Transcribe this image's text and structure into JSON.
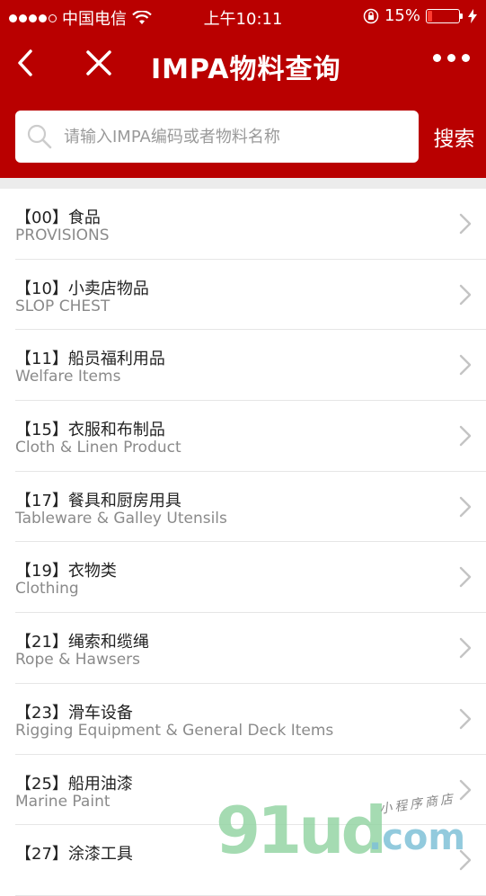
{
  "status_bar": {
    "carrier": "中国电信",
    "time": "上午10:11",
    "battery_percent": "15%",
    "battery_level": 0.15,
    "signal_bars_filled": 4,
    "signal_bars_total": 5
  },
  "nav": {
    "title": "IMPA物料查询",
    "back_icon": "chevron-left-icon",
    "close_icon": "close-icon",
    "more_icon": "more-dots-icon"
  },
  "search": {
    "placeholder": "请输入IMPA编码或者物料名称",
    "value": "",
    "button_label": "搜索"
  },
  "categories": [
    {
      "title": "【00】食品",
      "subtitle": "PROVISIONS"
    },
    {
      "title": "【10】小卖店物品",
      "subtitle": "SLOP CHEST"
    },
    {
      "title": "【11】船员福利用品",
      "subtitle": "Welfare Items"
    },
    {
      "title": "【15】衣服和布制品",
      "subtitle": "Cloth & Linen Product"
    },
    {
      "title": "【17】餐具和厨房用具",
      "subtitle": "Tableware & Galley Utensils"
    },
    {
      "title": "【19】衣物类",
      "subtitle": "Clothing"
    },
    {
      "title": "【21】绳索和缆绳",
      "subtitle": "Rope & Hawsers"
    },
    {
      "title": "【23】滑车设备",
      "subtitle": "Rigging Equipment & General Deck Items"
    },
    {
      "title": "【25】船用油漆",
      "subtitle": "Marine Paint"
    },
    {
      "title": "【27】涂漆工具",
      "subtitle": ""
    }
  ],
  "watermark": {
    "main": "91ud",
    "domain": ".com",
    "tagline": "小程序商店"
  },
  "colors": {
    "brand_red": "#b90000",
    "separator": "#e6e6e6",
    "subtitle_gray": "#8a8a8a"
  }
}
